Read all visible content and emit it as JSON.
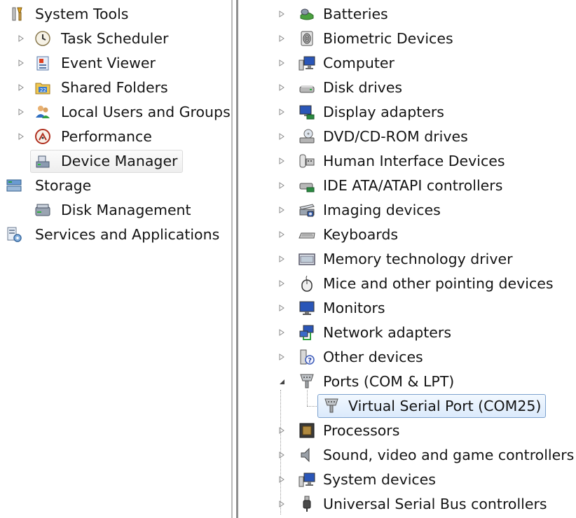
{
  "left_tree": {
    "system_tools": {
      "label": "System Tools",
      "children": [
        "Task Scheduler",
        "Event Viewer",
        "Shared Folders",
        "Local Users and Groups",
        "Performance",
        "Device Manager"
      ]
    },
    "storage": {
      "label": "Storage",
      "children": [
        "Disk Management"
      ]
    },
    "services": {
      "label": "Services and Applications"
    }
  },
  "device_tree": {
    "categories": [
      "Batteries",
      "Biometric Devices",
      "Computer",
      "Disk drives",
      "Display adapters",
      "DVD/CD-ROM drives",
      "Human Interface Devices",
      "IDE ATA/ATAPI controllers",
      "Imaging devices",
      "Keyboards",
      "Memory technology driver",
      "Mice and other pointing devices",
      "Monitors",
      "Network adapters",
      "Other devices",
      "Ports (COM & LPT)",
      "Processors",
      "Sound, video and game controllers",
      "System devices",
      "Universal Serial Bus controllers"
    ],
    "ports_children": [
      "Virtual Serial Port (COM25)"
    ]
  },
  "colors": {
    "selection_border": "#7da2ce",
    "selection_fill": "#dbeafc",
    "divider": "#8f8f8f"
  }
}
